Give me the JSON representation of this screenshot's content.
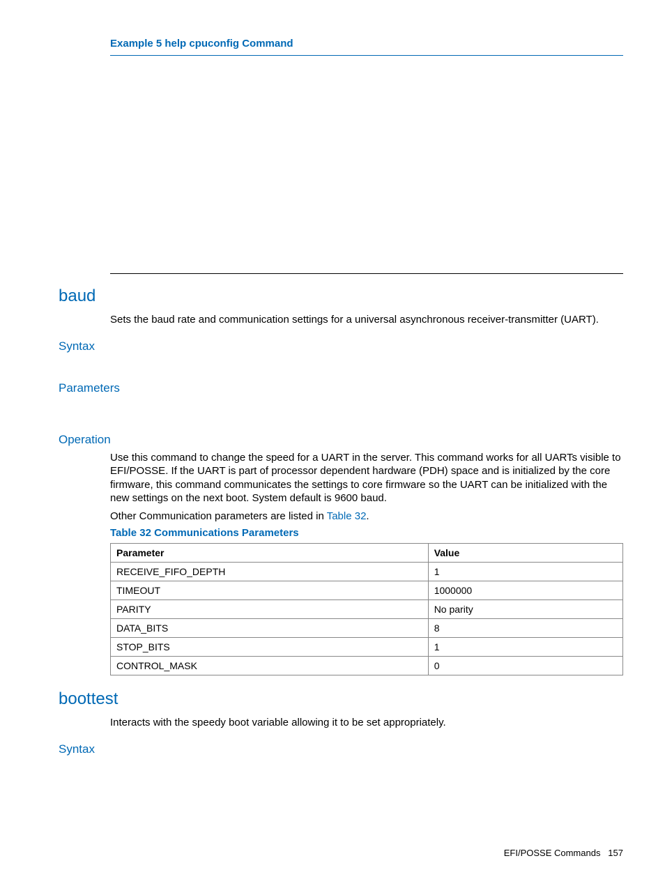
{
  "example": {
    "title": "Example 5 help cpuconfig Command"
  },
  "baud": {
    "heading": "baud",
    "description": "Sets the baud rate and communication settings for a universal asynchronous receiver-transmitter (UART).",
    "syntax_heading": "Syntax",
    "parameters_heading": "Parameters",
    "operation_heading": "Operation",
    "operation_text": "Use this command to change the speed for a UART in the server. This command works for all UARTs visible to EFI/POSSE. If the UART is part of processor dependent hardware (PDH) space and is initialized by the core firmware, this command communicates the settings to core firmware so the UART can be initialized with the new settings on the next boot. System default is 9600 baud.",
    "other_params_prefix": "Other Communication parameters are listed in ",
    "other_params_link": "Table 32",
    "other_params_suffix": ".",
    "table_caption": "Table 32 Communications Parameters",
    "table": {
      "headers": {
        "param": "Parameter",
        "value": "Value"
      },
      "rows": [
        {
          "param": "RECEIVE_FIFO_DEPTH",
          "value": "1"
        },
        {
          "param": "TIMEOUT",
          "value": "1000000"
        },
        {
          "param": "PARITY",
          "value": "No parity"
        },
        {
          "param": "DATA_BITS",
          "value": "8"
        },
        {
          "param": "STOP_BITS",
          "value": "1"
        },
        {
          "param": "CONTROL_MASK",
          "value": "0"
        }
      ]
    }
  },
  "boottest": {
    "heading": "boottest",
    "description": "Interacts with the speedy boot variable allowing it to be set appropriately.",
    "syntax_heading": "Syntax"
  },
  "footer": {
    "section": "EFI/POSSE Commands",
    "page": "157"
  }
}
